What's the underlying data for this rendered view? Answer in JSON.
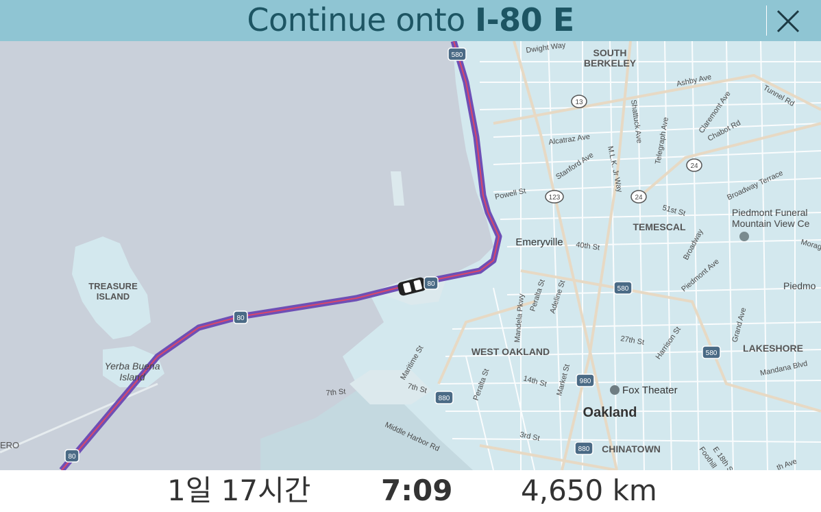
{
  "navigation": {
    "instruction_prefix": "Continue onto",
    "road": "I-80 E"
  },
  "footer": {
    "duration": "1일 17시간",
    "arrival_time": "7:09",
    "distance": "4,650 km"
  },
  "map": {
    "place_labels": {
      "south_berkeley_1": "SOUTH",
      "south_berkeley_2": "BERKELEY",
      "treasure_island_1": "TREASURE",
      "treasure_island_2": "ISLAND",
      "yerba_buena_1": "Yerba Buena",
      "yerba_buena_2": "Island",
      "emeryville": "Emeryville",
      "temescal": "TEMESCAL",
      "west_oakland": "WEST OAKLAND",
      "oakland": "Oakland",
      "lakeshore": "LAKESHORE",
      "chinatown": "CHINATOWN",
      "piedmont_funeral_1": "Piedmont Funeral",
      "piedmont_funeral_2": "Mountain View Ce",
      "piedmont": "Piedmo",
      "fox_theater": "Fox Theater",
      "edge_ero": "ERO"
    },
    "street_labels": {
      "dwight_way": "Dwight Way",
      "ashby_ave": "Ashby Ave",
      "tunnel_rd": "Tunnel Rd",
      "claremont_ave": "Claremont Ave",
      "chabot_rd": "Chabot Rd",
      "alcatraz_ave": "Alcatraz Ave",
      "stanford_ave": "Stanford Ave",
      "shattuck_ave": "Shattuck Ave",
      "telegraph_ave": "Telegraph Ave",
      "mlk_jr_way": "M.L.K. Jr Way",
      "powell_st": "Powell St",
      "broadway_terrace": "Broadway Terrace",
      "st_51": "51st St",
      "st_40": "40th St",
      "broadway": "Broadway",
      "piedmont_ave": "Piedmont Ave",
      "moraga": "Morag",
      "mandela_pkwy": "Mandela Pkwy",
      "peralta_st_n": "Peralta St",
      "adeline_st": "Adeline St",
      "st_27": "27th St",
      "harrison_st": "Harrison St",
      "grand_ave": "Grand Ave",
      "mandana_blvd": "Mandana Blvd",
      "maritime_st": "Maritime St",
      "st_7_west": "7th St",
      "st_7": "7th St",
      "st_14": "14th St",
      "peralta_st_s": "Peralta St",
      "market_st": "Market St",
      "middle_harbor_rd": "Middle Harbor Rd",
      "st_3": "3rd St",
      "foothill": "Foothill",
      "e_18th_st": "E 18th St",
      "th_ave": "th Ave"
    },
    "shields": {
      "i580_top": "580",
      "i580_mid": "580",
      "i580_east": "580",
      "i80_center": "80",
      "i80_near_car": "80",
      "i80_bottom": "80",
      "i880_a": "880",
      "i880_b": "880",
      "i980": "980",
      "ca13": "13",
      "ca24_a": "24",
      "ca24_b": "24",
      "ca123": "123"
    },
    "route_color": "#6e4fb5",
    "route_core_color": "#d9476a",
    "water_color": "#c9d0da",
    "land_color": "#d3e8ee"
  },
  "icons": {
    "close": "close-icon",
    "car": "car-icon",
    "poi": "poi-icon"
  }
}
